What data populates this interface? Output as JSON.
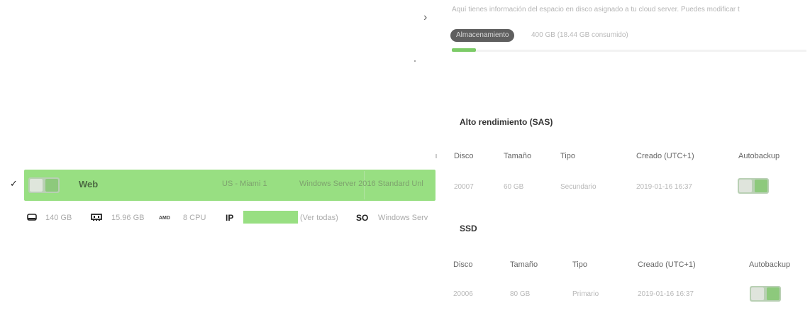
{
  "intro": "Aquí tienes información del espacio en disco asignado a tu cloud server. Puedes modificar t",
  "storage": {
    "badge": "Almacenamiento",
    "summary": "400 GB (18.44 GB consumido)",
    "used_fraction": 0.046
  },
  "server_row": {
    "selected": true,
    "check": "✓",
    "name": "Web",
    "location": "US - Miami 1",
    "os": "Windows Server 2016 Standard Unl",
    "toggle_icon": "toggle-switch-icon"
  },
  "specs": {
    "disk": "140 GB",
    "ram": "15.96 GB",
    "cpu_brand": "AMD",
    "cpu": "8 CPU",
    "ip_label": "IP",
    "ip_link": "(Ver todas)",
    "so_label": "SO",
    "os": "Windows Serv"
  },
  "sections": [
    {
      "title": "Alto rendimiento (SAS)",
      "headers": [
        "Disco",
        "Tamaño",
        "Tipo",
        "Creado (UTC+1)",
        "Autobackup"
      ],
      "rows": [
        {
          "disco": "20007",
          "tamano": "60 GB",
          "tipo": "Secundario",
          "creado": "2019-01-16 16:37",
          "autobackup": true
        }
      ]
    },
    {
      "title": "SSD",
      "headers": [
        "Disco",
        "Tamaño",
        "Tipo",
        "Creado (UTC+1)",
        "Autobackup"
      ],
      "rows": [
        {
          "disco": "20006",
          "tamano": "80 GB",
          "tipo": "Primario",
          "creado": "2019-01-16 16:37",
          "autobackup": true
        }
      ]
    }
  ],
  "colors": {
    "row_highlight": "#98df82",
    "badge_bg": "#5f5f5f",
    "progress": "#7ccb67",
    "toggle_on": "#8dc97c"
  },
  "icons": [
    "chevron-right-icon",
    "hdd-icon",
    "ram-icon",
    "amd-logo-icon",
    "toggle-switch-icon"
  ]
}
